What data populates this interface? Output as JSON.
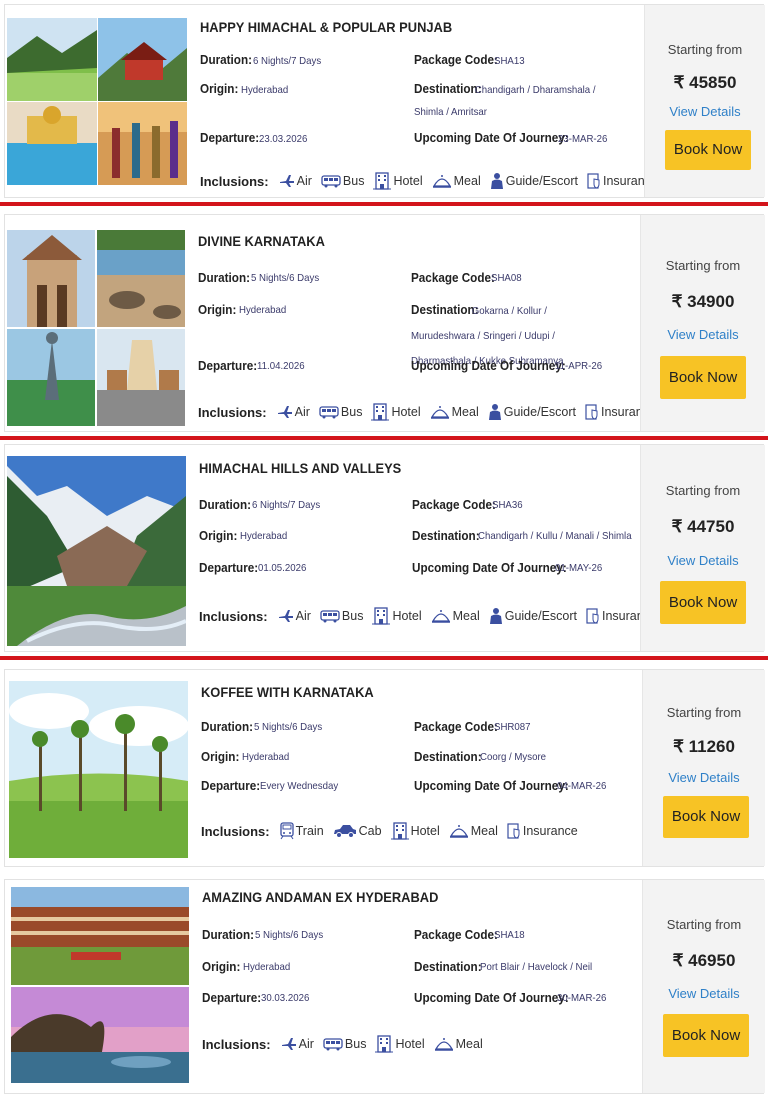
{
  "labels": {
    "duration": "Duration:",
    "origin": "Origin:",
    "departure": "Departure:",
    "package_code": "Package Code:",
    "destination": "Destination:",
    "upcoming": "Upcoming Date Of Journey:",
    "inclusions": "Inclusions:",
    "starting_from": "Starting from",
    "view_details": "View Details",
    "book_now": "Book Now"
  },
  "packages": [
    {
      "title": "HAPPY HIMACHAL & POPULAR PUNJAB",
      "duration": "6 Nights/7 Days",
      "origin": "Hyderabad",
      "departure": "23.03.2026",
      "package_code": "SHA13",
      "destination": "Chandigarh / Dharamshala / Shimla / Amritsar",
      "upcoming": "23-MAR-26",
      "price": "₹ 45850",
      "inclusions": [
        "Air",
        "Bus",
        "Hotel",
        "Meal",
        "Guide/Escort",
        "Insurance"
      ]
    },
    {
      "title": "DIVINE KARNATAKA",
      "duration": "5 Nights/6 Days",
      "origin": "Hyderabad",
      "departure": "11.04.2026",
      "package_code": "SHA08",
      "destination": "Gokarna / Kollur / Murudeshwara / Sringeri / Udupi / Dharmasthala / Kukke Subramanya",
      "upcoming": "11-APR-26",
      "price": "₹ 34900",
      "inclusions": [
        "Air",
        "Bus",
        "Hotel",
        "Meal",
        "Guide/Escort",
        "Insurance"
      ]
    },
    {
      "title": "HIMACHAL HILLS AND VALLEYS",
      "duration": "6 Nights/7 Days",
      "origin": "Hyderabad",
      "departure": "01.05.2026",
      "package_code": "SHA36",
      "destination": "Chandigarh / Kullu / Manali / Shimla",
      "upcoming": "01-MAY-26",
      "price": "₹ 44750",
      "inclusions": [
        "Air",
        "Bus",
        "Hotel",
        "Meal",
        "Guide/Escort",
        "Insurance"
      ]
    },
    {
      "title": "KOFFEE WITH KARNATAKA",
      "duration": "5 Nights/6 Days",
      "origin": "Hyderabad",
      "departure": "Every Wednesday",
      "package_code": "SHR087",
      "destination": "Coorg / Mysore",
      "upcoming": "04-MAR-26",
      "price": "₹ 11260",
      "inclusions": [
        "Train",
        "Cab",
        "Hotel",
        "Meal",
        "Insurance"
      ]
    },
    {
      "title": "AMAZING ANDAMAN EX HYDERABAD",
      "duration": "5 Nights/6 Days",
      "origin": "Hyderabad",
      "departure": "30.03.2026",
      "package_code": "SHA18",
      "destination": "Port Blair / Havelock / Neil",
      "upcoming": "30-MAR-26",
      "price": "₹ 46950",
      "inclusions": [
        "Air",
        "Bus",
        "Hotel",
        "Meal"
      ]
    }
  ],
  "colors": {
    "separator": "#d3141b",
    "book_button": "#f7c325",
    "link": "#2f80c8",
    "icon": "#3b4fa0"
  }
}
